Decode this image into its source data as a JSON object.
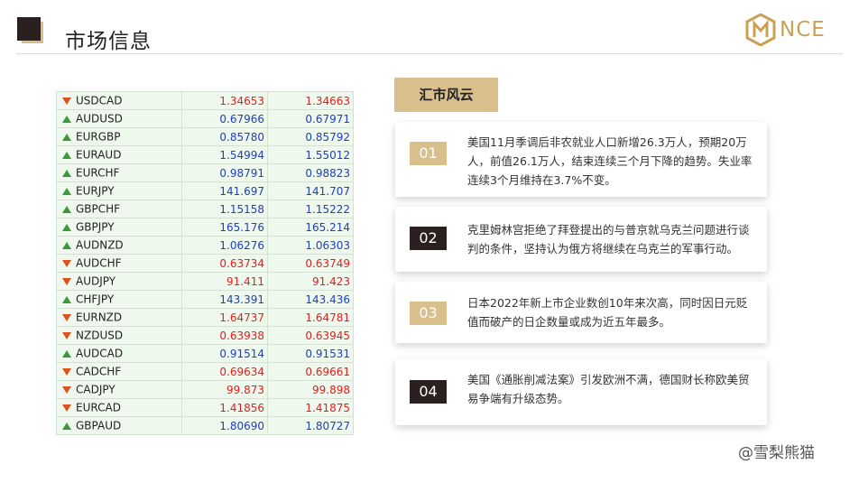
{
  "header": {
    "title": "市场信息",
    "logo_text": "NCE",
    "accent_gold": "#d8bf8c",
    "accent_dark": "#2a201f"
  },
  "quotes": [
    {
      "symbol": "USDCAD",
      "bid": "1.34653",
      "ask": "1.34663",
      "direction": "down"
    },
    {
      "symbol": "AUDUSD",
      "bid": "0.67966",
      "ask": "0.67971",
      "direction": "up"
    },
    {
      "symbol": "EURGBP",
      "bid": "0.85780",
      "ask": "0.85792",
      "direction": "up"
    },
    {
      "symbol": "EURAUD",
      "bid": "1.54994",
      "ask": "1.55012",
      "direction": "up"
    },
    {
      "symbol": "EURCHF",
      "bid": "0.98791",
      "ask": "0.98823",
      "direction": "up"
    },
    {
      "symbol": "EURJPY",
      "bid": "141.697",
      "ask": "141.707",
      "direction": "up"
    },
    {
      "symbol": "GBPCHF",
      "bid": "1.15158",
      "ask": "1.15222",
      "direction": "up"
    },
    {
      "symbol": "GBPJPY",
      "bid": "165.176",
      "ask": "165.214",
      "direction": "up"
    },
    {
      "symbol": "AUDNZD",
      "bid": "1.06276",
      "ask": "1.06303",
      "direction": "up"
    },
    {
      "symbol": "AUDCHF",
      "bid": "0.63734",
      "ask": "0.63749",
      "direction": "down"
    },
    {
      "symbol": "AUDJPY",
      "bid": "91.411",
      "ask": "91.423",
      "direction": "down"
    },
    {
      "symbol": "CHFJPY",
      "bid": "143.391",
      "ask": "143.436",
      "direction": "up"
    },
    {
      "symbol": "EURNZD",
      "bid": "1.64737",
      "ask": "1.64781",
      "direction": "down"
    },
    {
      "symbol": "NZDUSD",
      "bid": "0.63938",
      "ask": "0.63945",
      "direction": "down"
    },
    {
      "symbol": "AUDCAD",
      "bid": "0.91514",
      "ask": "0.91531",
      "direction": "up"
    },
    {
      "symbol": "CADCHF",
      "bid": "0.69634",
      "ask": "0.69661",
      "direction": "down"
    },
    {
      "symbol": "CADJPY",
      "bid": "99.873",
      "ask": "99.898",
      "direction": "down"
    },
    {
      "symbol": "EURCAD",
      "bid": "1.41856",
      "ask": "1.41875",
      "direction": "down"
    },
    {
      "symbol": "GBPAUD",
      "bid": "1.80690",
      "ask": "1.80727",
      "direction": "up"
    }
  ],
  "news": {
    "header": "汇市风云",
    "items": [
      {
        "num": "01",
        "style": "gold",
        "text": "美国11月季调后非农就业人口新增26.3万人，预期20万人，前值26.1万人，结束连续三个月下降的趋势。失业率连续3个月维持在3.7%不变。"
      },
      {
        "num": "02",
        "style": "dark",
        "text": "克里姆林宫拒绝了拜登提出的与普京就乌克兰问题进行谈判的条件，坚持认为俄方将继续在乌克兰的军事行动。"
      },
      {
        "num": "03",
        "style": "gold",
        "text": "日本2022年新上市企业数创10年来次高，同时因日元贬值而破产的日企数量或成为近五年最多。"
      },
      {
        "num": "04",
        "style": "dark",
        "text": "美国《通胀削减法案》引发欧洲不满，德国财长称欧美贸易争端有升级态势。"
      }
    ]
  },
  "watermark": "@雪梨熊猫"
}
